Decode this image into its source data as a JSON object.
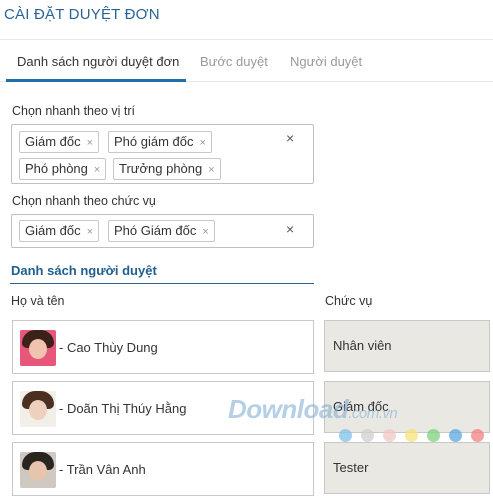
{
  "header": {
    "title": "CÀI ĐẶT DUYỆT ĐƠN"
  },
  "tabs": [
    {
      "label": "Danh sách người duyệt đơn",
      "active": true
    },
    {
      "label": "Bước duyệt",
      "active": false
    },
    {
      "label": "Người duyệt",
      "active": false
    }
  ],
  "position_filter": {
    "label": "Chọn nhanh theo vị trí",
    "tags": [
      "Giám đốc",
      "Phó giám đốc",
      "Phó phòng",
      "Trưởng phòng"
    ],
    "remove_glyph": "×",
    "clear_glyph": "×"
  },
  "title_filter": {
    "label": "Chọn nhanh theo chức vụ",
    "tags": [
      "Giám đốc",
      "Phó Giám đốc"
    ],
    "remove_glyph": "×",
    "clear_glyph": "×"
  },
  "approvers": {
    "title": "Danh sách người duyệt",
    "name_header": "Họ và tên",
    "role_header": "Chức vụ",
    "rows": [
      {
        "name": "- Cao Thùy Dung",
        "role": "Nhân viên",
        "avatar_hair": "#3a2218",
        "avatar_skin": "#f0c2b0",
        "avatar_bg": "#e8577a"
      },
      {
        "name": "- Doãn Thị Thúy Hằng",
        "role": "Giám đốc",
        "avatar_hair": "#4a3020",
        "avatar_skin": "#efcfbd",
        "avatar_bg": "#f2efe9"
      },
      {
        "name": "- Trần Vân Anh",
        "role": "Tester",
        "avatar_hair": "#2b2520",
        "avatar_skin": "#e6c4ad",
        "avatar_bg": "#cfc9c2"
      }
    ]
  },
  "watermark": {
    "text": "Download",
    "suffix": ".com.vn",
    "dot_colors": [
      "#7fc1e8",
      "#cfcfcf",
      "#f2c6c6",
      "#f6e27a",
      "#7fd07f",
      "#5aa8e0",
      "#f08080"
    ]
  }
}
